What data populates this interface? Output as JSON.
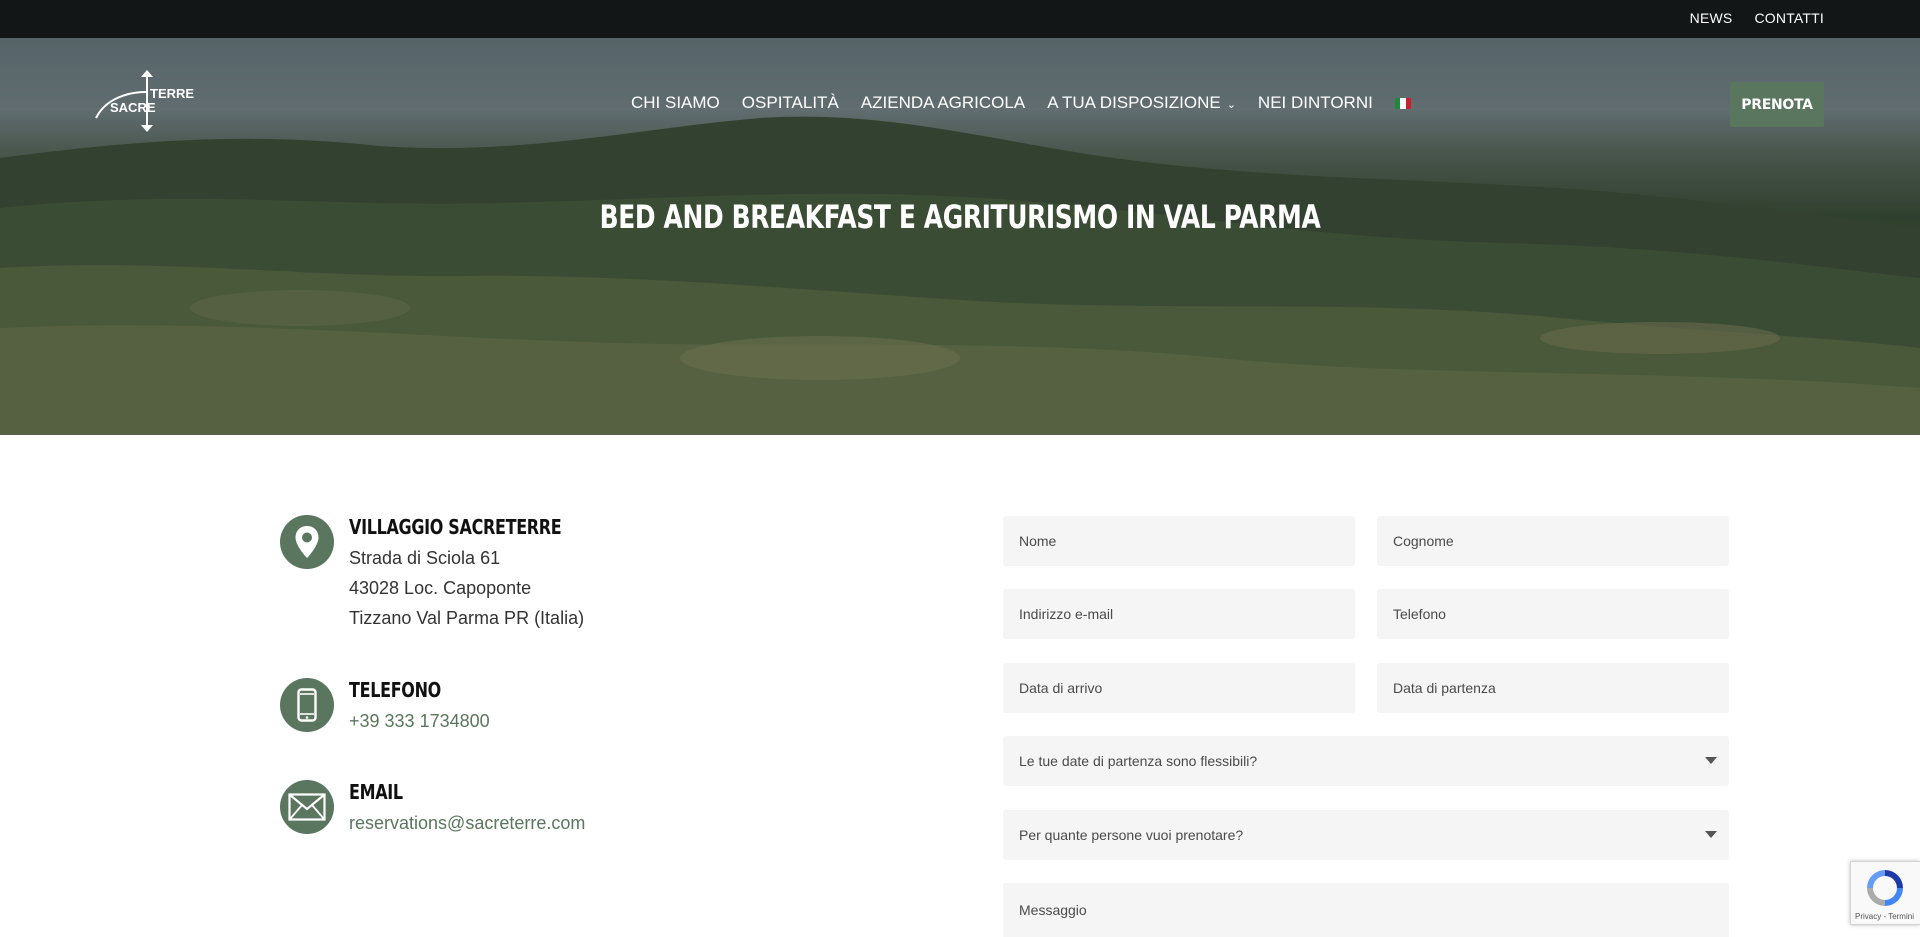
{
  "topbar": {
    "links": [
      "NEWS",
      "CONTATTI"
    ]
  },
  "logo": {
    "word1": "SACRE",
    "word2": "TERRE"
  },
  "nav": {
    "items": [
      "CHI SIAMO",
      "OSPITALITÀ",
      "AZIENDA AGRICOLA",
      "A TUA DISPOSIZIONE",
      "NEI DINTORNI"
    ],
    "language_flag": "italian-flag"
  },
  "cta": {
    "label": "PRENOTA"
  },
  "hero": {
    "title": "BED AND BREAKFAST E AGRITURISMO IN VAL PARMA"
  },
  "contact": {
    "address": {
      "title": "VILLAGGIO SACRETERRE",
      "lines": [
        "Strada di Sciola 61",
        "43028 Loc. Capoponte",
        "Tizzano Val Parma PR (Italia)"
      ]
    },
    "phone": {
      "title": "TELEFONO",
      "value": "+39 333 1734800"
    },
    "email": {
      "title": "EMAIL",
      "value": "reservations@sacreterre.com"
    }
  },
  "form": {
    "nome": "Nome",
    "cognome": "Cognome",
    "email": "Indirizzo e-mail",
    "telefono": "Telefono",
    "arrivo": "Data di arrivo",
    "partenza": "Data di partenza",
    "flessibili": "Le tue date di partenza sono flessibili?",
    "persone": "Per quante persone vuoi prenotare?",
    "messaggio": "Messaggio"
  },
  "recaptcha": {
    "text": "Privacy - Termini"
  },
  "colors": {
    "accent": "#5a765e",
    "topbar": "#121616",
    "field_bg": "#f5f5f5"
  }
}
